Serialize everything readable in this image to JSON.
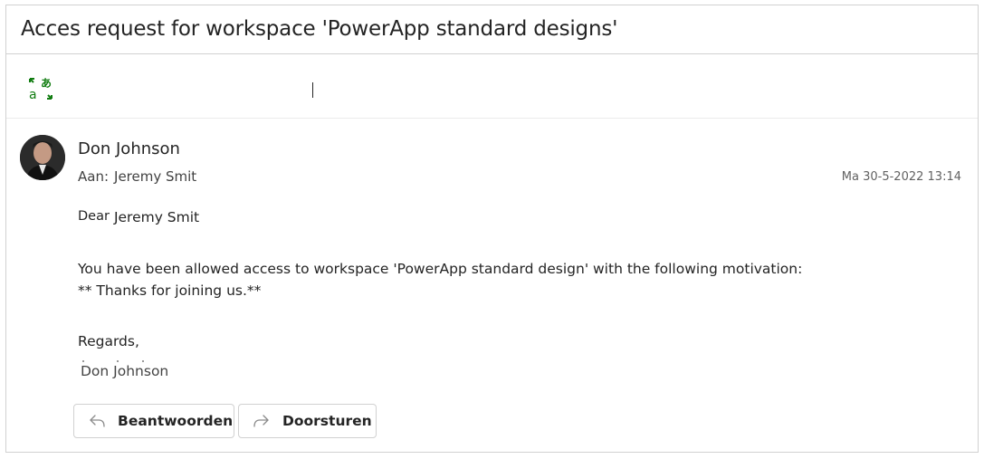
{
  "email": {
    "subject": "Acces request for workspace 'PowerApp standard designs'",
    "sender_name": "Don Johnson",
    "to_label": "Aan:",
    "to_name": "Jeremy Smit",
    "timestamp": "Ma 30-5-2022 13:14"
  },
  "toolbar": {
    "translate_icon": "translate-icon"
  },
  "body": {
    "dear_label": "Dear",
    "dear_name": "Jeremy Smit",
    "line1": "You have been allowed access to workspace 'PowerApp standard design' with the following motivation:",
    "line2": "** Thanks for joining us.**",
    "regards": "Regards,",
    "signature": "Don Johnson"
  },
  "actions": {
    "reply_label": "Beantwoorden",
    "reply_icon": "reply-arrow-icon",
    "forward_label": "Doorsturen",
    "forward_icon": "forward-arrow-icon"
  },
  "colors": {
    "translate_green": "#107c10",
    "border": "#d1d1d1",
    "text": "#242424"
  }
}
